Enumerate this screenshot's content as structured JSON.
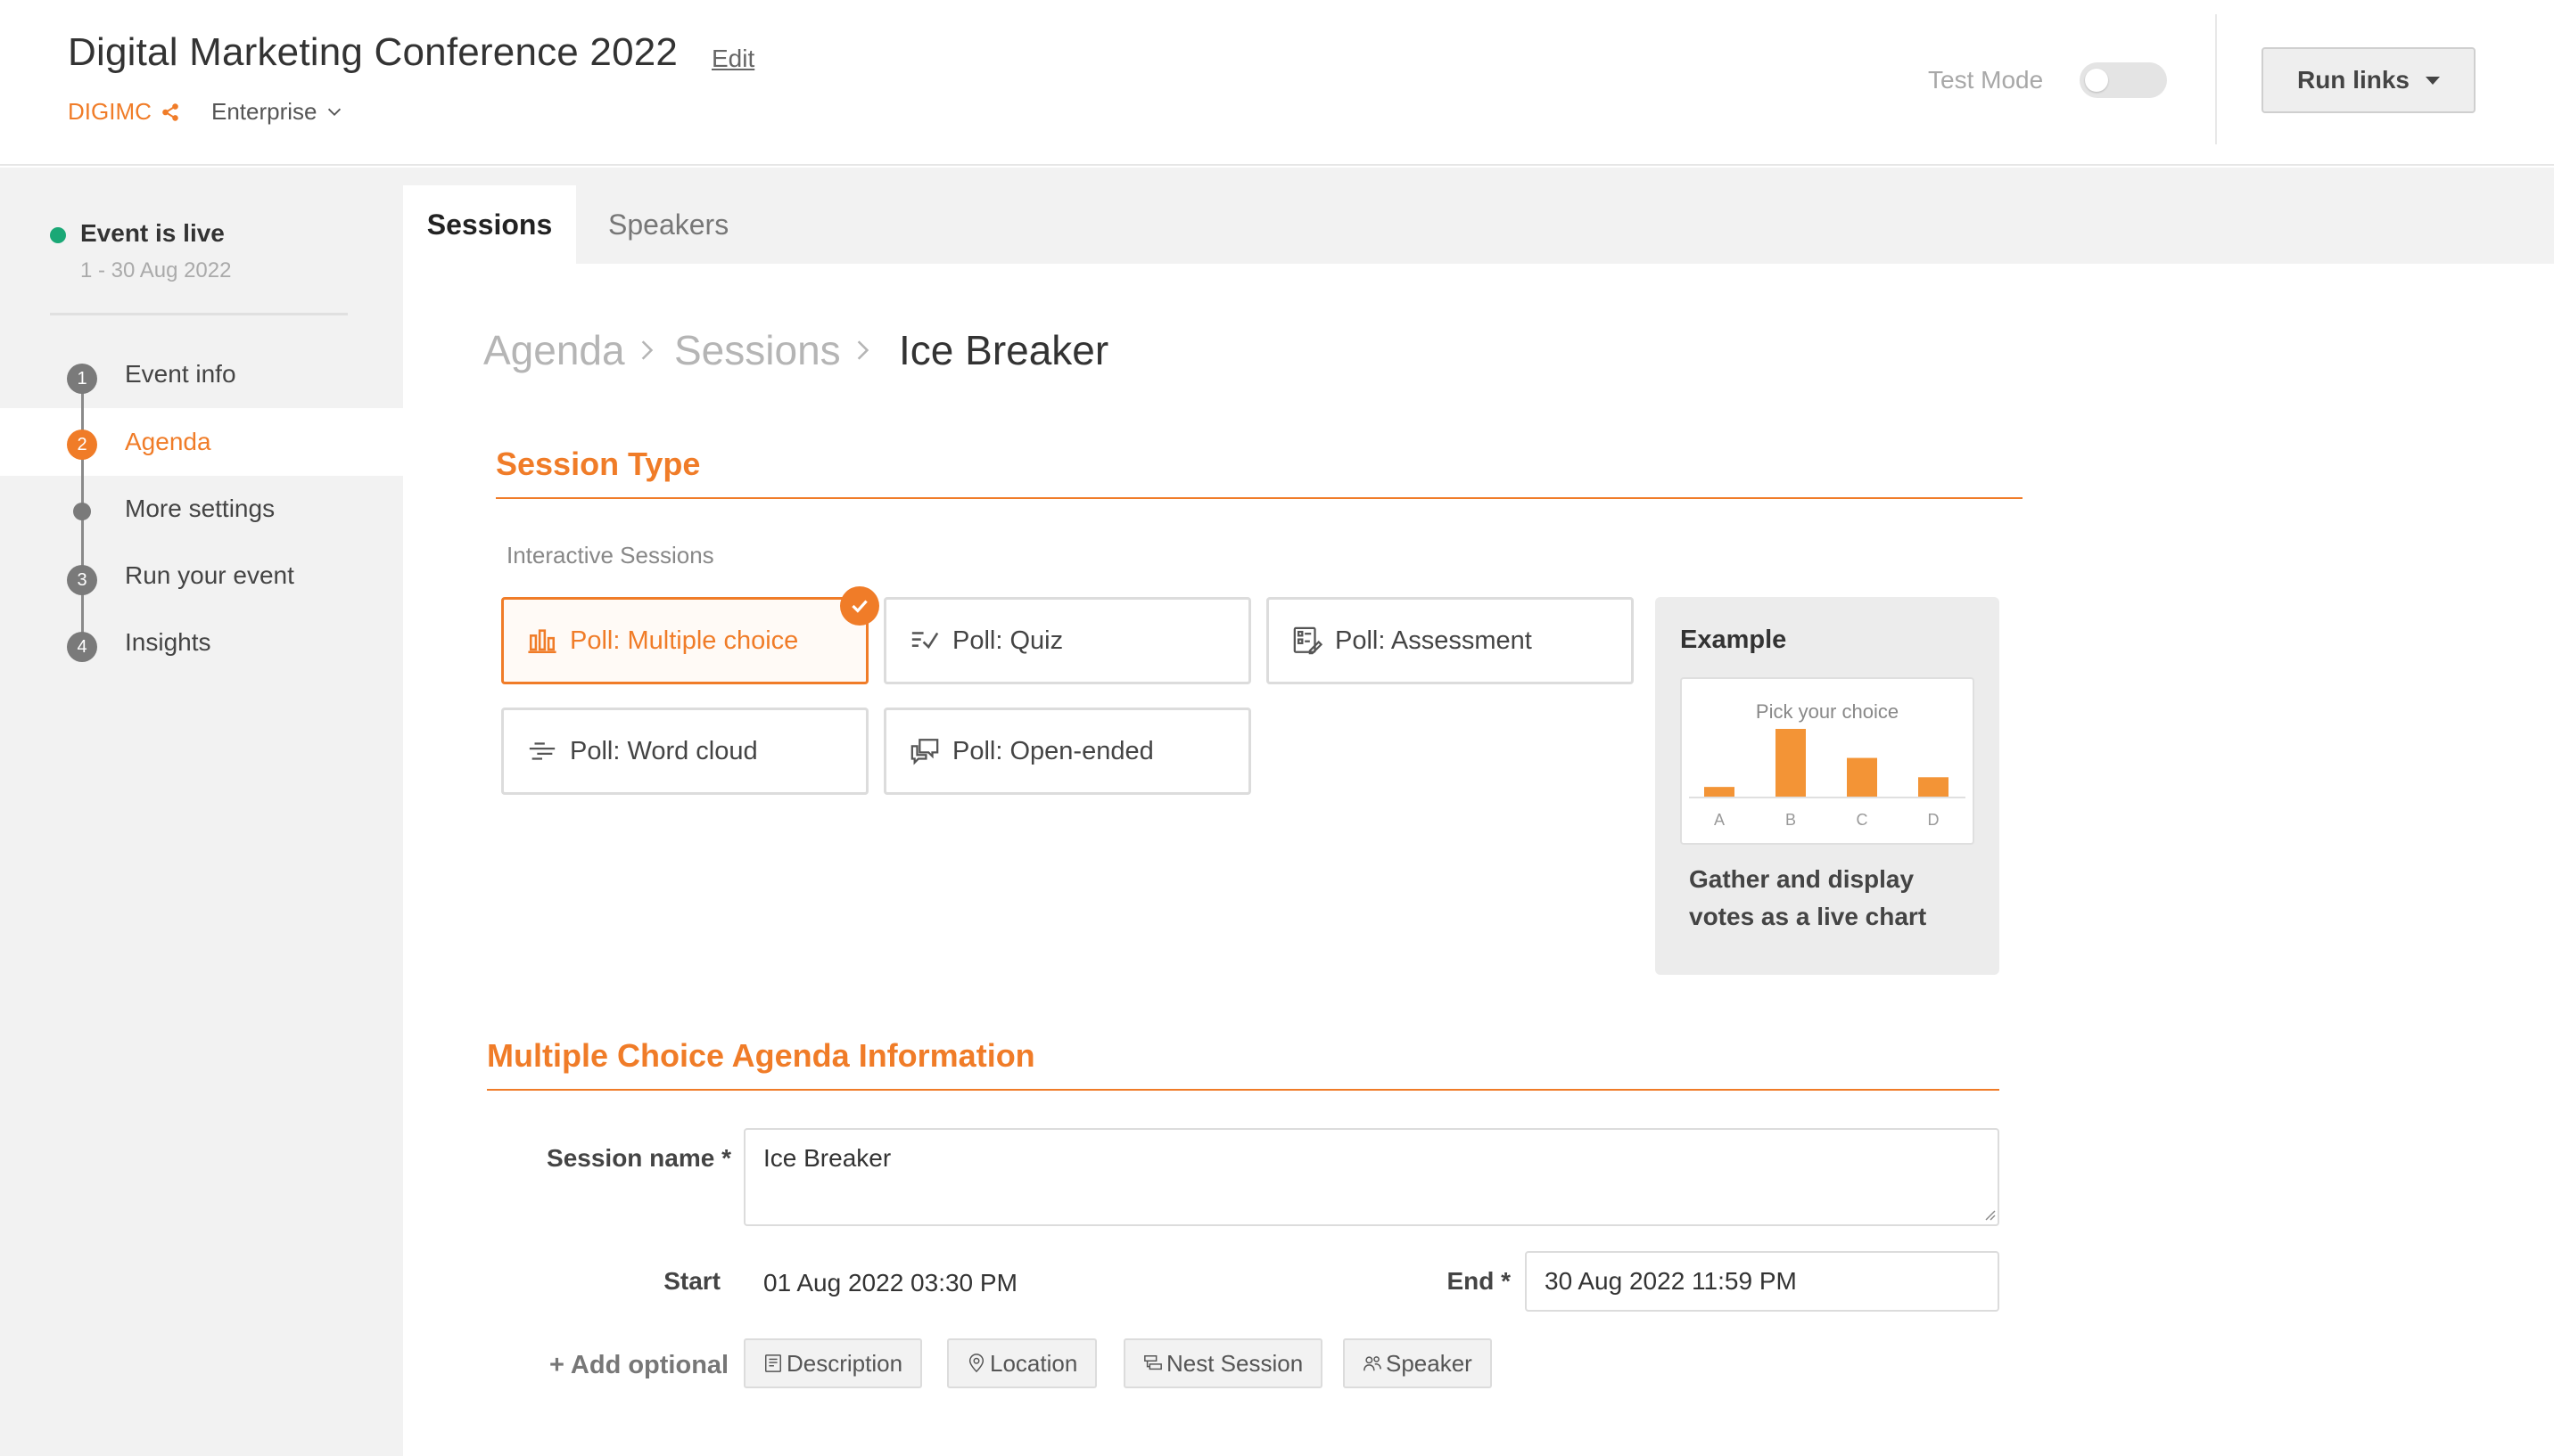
{
  "header": {
    "title": "Digital Marketing Conference 2022",
    "edit_label": "Edit",
    "org_code": "DIGIMC",
    "plan": "Enterprise",
    "test_mode_label": "Test Mode",
    "test_mode_on": false,
    "run_links_label": "Run links"
  },
  "sidebar": {
    "status": "Event is live",
    "dates": "1 - 30 Aug 2022",
    "steps": [
      {
        "number": "1",
        "label": "Event info"
      },
      {
        "number": "2",
        "label": "Agenda",
        "active": true
      },
      {
        "number": "",
        "label": "More settings"
      },
      {
        "number": "3",
        "label": "Run your event"
      },
      {
        "number": "4",
        "label": "Insights"
      }
    ]
  },
  "tabs": [
    {
      "label": "Sessions",
      "active": true
    },
    {
      "label": "Speakers",
      "active": false
    }
  ],
  "breadcrumb": [
    "Agenda",
    "Sessions",
    "Ice Breaker"
  ],
  "session_type": {
    "title": "Session Type",
    "group_label": "Interactive Sessions",
    "options": [
      {
        "label": "Poll: Multiple choice",
        "icon": "bar-chart-icon",
        "selected": true
      },
      {
        "label": "Poll: Quiz",
        "icon": "quiz-icon",
        "selected": false
      },
      {
        "label": "Poll: Assessment",
        "icon": "assessment-icon",
        "selected": false
      },
      {
        "label": "Poll: Word cloud",
        "icon": "word-cloud-icon",
        "selected": false
      },
      {
        "label": "Poll: Open-ended",
        "icon": "chat-bubbles-icon",
        "selected": false
      }
    ],
    "example": {
      "title": "Example",
      "question": "Pick your choice",
      "description": "Gather and display votes as a live chart"
    }
  },
  "chart_data": {
    "type": "bar",
    "title": "Pick your choice",
    "categories": [
      "A",
      "B",
      "C",
      "D"
    ],
    "values": [
      1,
      7,
      4,
      2
    ],
    "color": "#f39436"
  },
  "agenda_info": {
    "title": "Multiple Choice Agenda Information",
    "session_name_label": "Session name *",
    "session_name_value": "Ice Breaker",
    "start_label": "Start",
    "start_value": "01 Aug 2022 03:30 PM",
    "end_label": "End *",
    "end_value": "30 Aug 2022 11:59 PM",
    "add_optional_label": "+ Add optional",
    "optional_buttons": [
      {
        "label": "Description",
        "icon": "description-icon"
      },
      {
        "label": "Location",
        "icon": "location-pin-icon"
      },
      {
        "label": "Nest Session",
        "icon": "nest-icon"
      },
      {
        "label": "Speaker",
        "icon": "people-icon"
      }
    ]
  },
  "colors": {
    "accent": "#f07c28",
    "live": "#1aa876"
  }
}
